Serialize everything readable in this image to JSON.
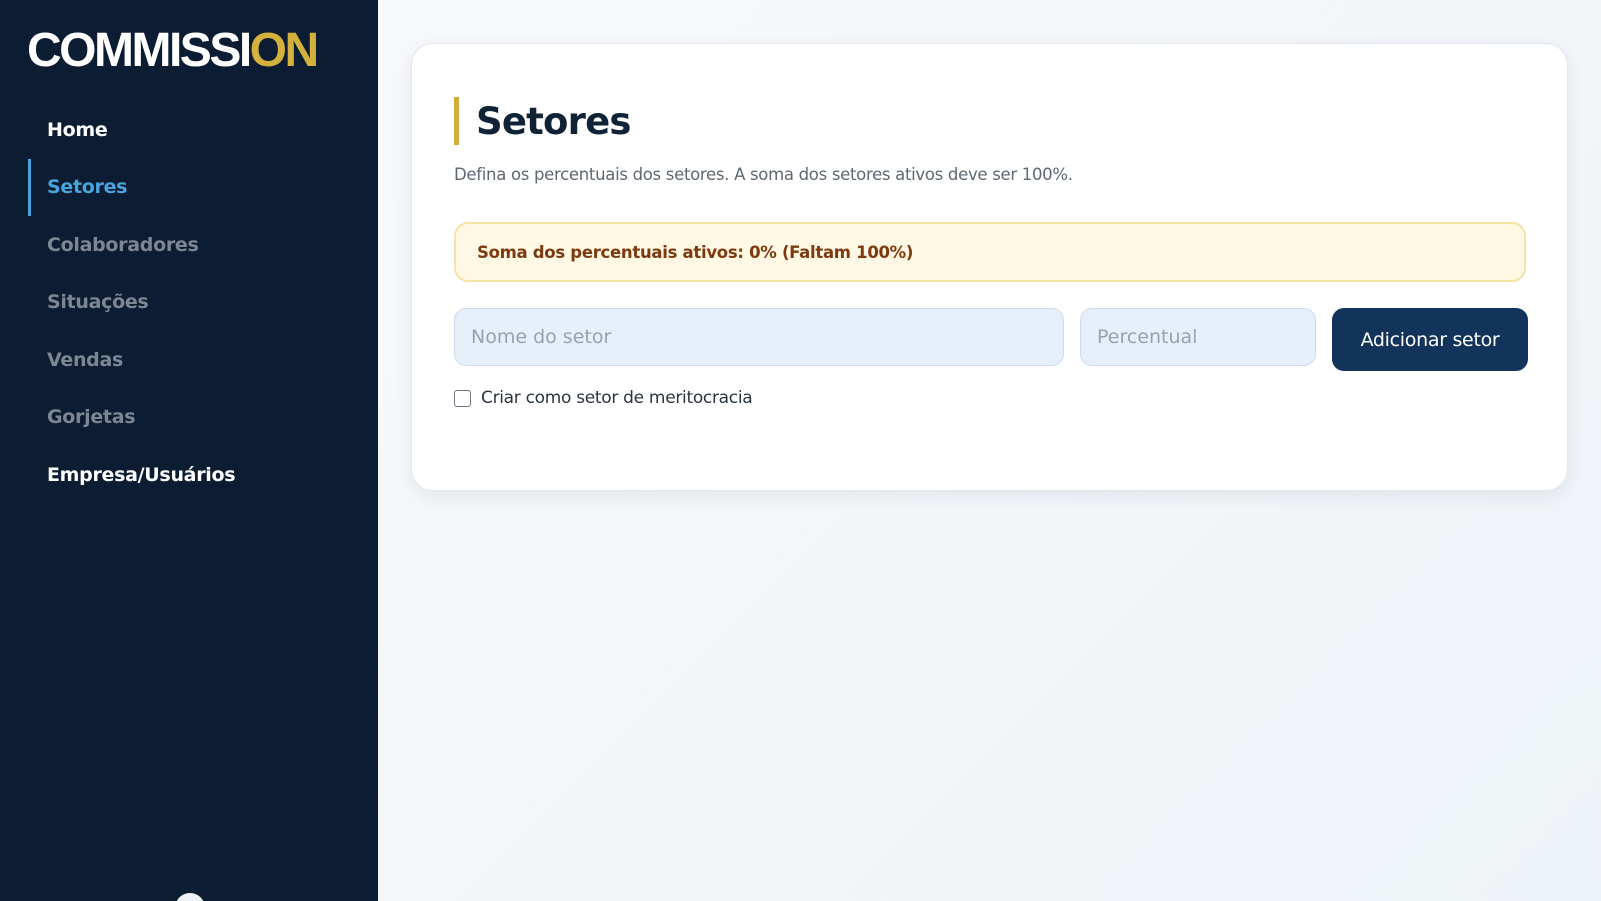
{
  "brand": {
    "logo_main": "COMMISSI",
    "logo_accent": "ON"
  },
  "sidebar": {
    "items": [
      {
        "label": "Home",
        "state": "normal"
      },
      {
        "label": "Setores",
        "state": "active"
      },
      {
        "label": "Colaboradores",
        "state": "muted"
      },
      {
        "label": "Situações",
        "state": "muted"
      },
      {
        "label": "Vendas",
        "state": "muted"
      },
      {
        "label": "Gorjetas",
        "state": "muted"
      },
      {
        "label": "Empresa/Usuários",
        "state": "normal"
      }
    ]
  },
  "page": {
    "title": "Setores",
    "subtitle": "Defina os percentuais dos setores. A soma dos setores ativos deve ser 100%."
  },
  "alert": {
    "text": "Soma dos percentuais ativos: 0% (Faltam 100%)"
  },
  "form": {
    "name_placeholder": "Nome do setor",
    "name_value": "",
    "percent_placeholder": "Percentual",
    "percent_value": "",
    "add_button_label": "Adicionar setor",
    "meritocracy_label": "Criar como setor de meritocracia",
    "meritocracy_checked": false
  },
  "colors": {
    "sidebar_bg": "#0c1d33",
    "accent_blue": "#4aa3dc",
    "accent_gold": "#d6ab3a",
    "button_bg": "#13345a",
    "alert_bg": "#fef8e4",
    "alert_text": "#7c3a0e"
  }
}
